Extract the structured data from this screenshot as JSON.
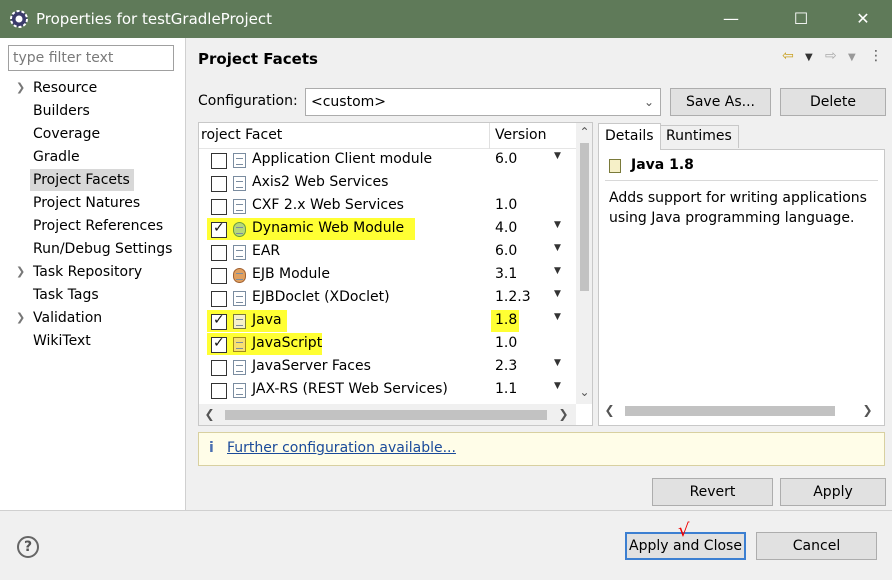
{
  "window": {
    "title": "Properties for testGradleProject",
    "minimize": "—",
    "maximize": "☐",
    "close": "✕"
  },
  "sidebar": {
    "filter_placeholder": "type filter text",
    "items": [
      {
        "label": "Resource",
        "expandable": true
      },
      {
        "label": "Builders",
        "expandable": false
      },
      {
        "label": "Coverage",
        "expandable": false
      },
      {
        "label": "Gradle",
        "expandable": false
      },
      {
        "label": "Project Facets",
        "expandable": false,
        "selected": true
      },
      {
        "label": "Project Natures",
        "expandable": false
      },
      {
        "label": "Project References",
        "expandable": false
      },
      {
        "label": "Run/Debug Settings",
        "expandable": false
      },
      {
        "label": "Task Repository",
        "expandable": true
      },
      {
        "label": "Task Tags",
        "expandable": false
      },
      {
        "label": "Validation",
        "expandable": true
      },
      {
        "label": "WikiText",
        "expandable": false
      }
    ]
  },
  "page": {
    "title": "Project Facets",
    "nav_back": "⇦",
    "nav_forward": "⇨",
    "menu": "⋮"
  },
  "configuration": {
    "label": "Configuration:",
    "value": "<custom>",
    "save_as": "Save As...",
    "delete": "Delete"
  },
  "facets": {
    "col_facet": "roject Facet",
    "col_version": "Version",
    "rows": [
      {
        "name": "Application Client module",
        "version": "6.0",
        "checked": false,
        "dropdown": true,
        "icon": "doc",
        "highlight": false
      },
      {
        "name": "Axis2 Web Services",
        "version": "",
        "checked": false,
        "dropdown": false,
        "icon": "doc",
        "highlight": false
      },
      {
        "name": "CXF 2.x Web Services",
        "version": "1.0",
        "checked": false,
        "dropdown": false,
        "icon": "doc",
        "highlight": false
      },
      {
        "name": "Dynamic Web Module",
        "version": "4.0",
        "checked": true,
        "dropdown": true,
        "icon": "web",
        "highlight": true
      },
      {
        "name": "EAR",
        "version": "6.0",
        "checked": false,
        "dropdown": true,
        "icon": "doc",
        "highlight": false
      },
      {
        "name": "EJB Module",
        "version": "3.1",
        "checked": false,
        "dropdown": true,
        "icon": "ejb",
        "highlight": false
      },
      {
        "name": "EJBDoclet (XDoclet)",
        "version": "1.2.3",
        "checked": false,
        "dropdown": true,
        "icon": "doc",
        "highlight": false
      },
      {
        "name": "Java",
        "version": "1.8",
        "checked": true,
        "dropdown": true,
        "icon": "java",
        "highlight": true,
        "version_highlight": true
      },
      {
        "name": "JavaScript",
        "version": "1.0",
        "checked": true,
        "dropdown": false,
        "icon": "js",
        "highlight": true
      },
      {
        "name": "JavaServer Faces",
        "version": "2.3",
        "checked": false,
        "dropdown": true,
        "icon": "doc",
        "highlight": false
      },
      {
        "name": "JAX-RS (REST Web Services)",
        "version": "1.1",
        "checked": false,
        "dropdown": true,
        "icon": "doc",
        "highlight": false
      }
    ]
  },
  "details": {
    "tab_details": "Details",
    "tab_runtimes": "Runtimes",
    "facet_name": "Java 1.8",
    "description": "Adds support for writing applications using Java programming language."
  },
  "info": {
    "icon": "i",
    "link": "Further configuration available..."
  },
  "buttons": {
    "revert": "Revert",
    "apply": "Apply",
    "apply_and_close": "Apply and Close",
    "cancel": "Cancel",
    "help": "?"
  },
  "colors": {
    "titlebar": "#5f7a59",
    "highlight": "#ffff33",
    "link": "#1a4a9a"
  }
}
